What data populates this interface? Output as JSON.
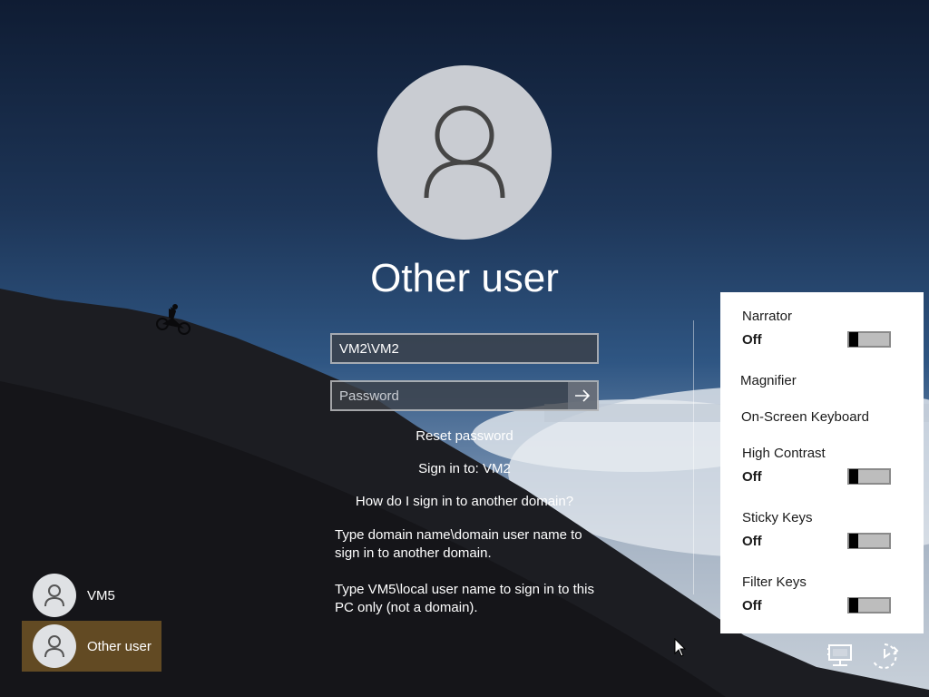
{
  "login": {
    "user_title": "Other user",
    "username_value": "VM2\\VM2",
    "password_placeholder": "Password",
    "reset_password": "Reset password",
    "sign_in_to": "Sign in to: VM2",
    "other_domain_link": "How do I sign in to another domain?",
    "hint_domain": "Type domain name\\domain user name to sign in to another domain.",
    "hint_local": "Type VM5\\local user name to sign in to this PC only (not a domain)."
  },
  "users": [
    {
      "label": "VM5",
      "selected": false
    },
    {
      "label": "Other user",
      "selected": true
    }
  ],
  "ease_of_access": {
    "narrator": {
      "label": "Narrator",
      "state": "Off"
    },
    "magnifier": {
      "label": "Magnifier"
    },
    "on_screen_keyboard": {
      "label": "On-Screen Keyboard"
    },
    "high_contrast": {
      "label": "High Contrast",
      "state": "Off"
    },
    "sticky_keys": {
      "label": "Sticky Keys",
      "state": "Off"
    },
    "filter_keys": {
      "label": "Filter Keys",
      "state": "Off"
    }
  },
  "tray": {
    "network_icon": "network-icon",
    "ease_of_access_icon": "ease-of-access-icon"
  },
  "colors": {
    "selected_tile": "#705426",
    "panel_bg": "#ffffff"
  }
}
